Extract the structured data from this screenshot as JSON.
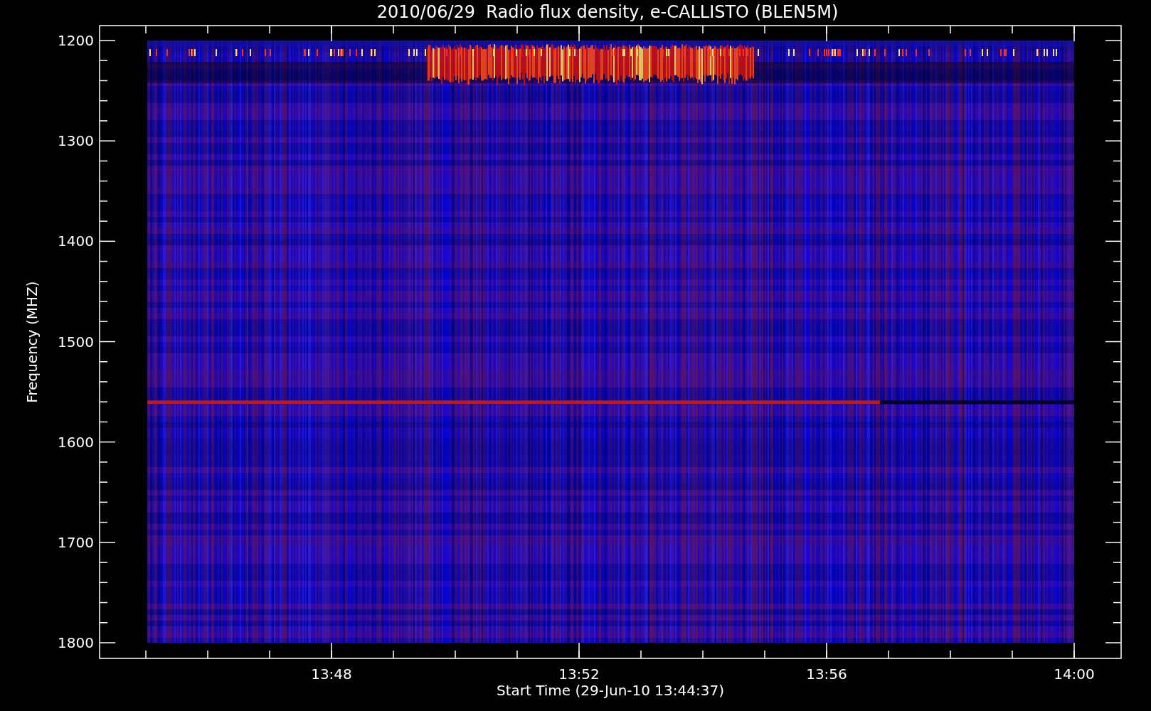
{
  "title": "2010/06/29  Radio flux density, e-CALLISTO (BLEN5M)",
  "y_axis": {
    "label": "Frequency (MHZ)",
    "ticks": [
      "1200",
      "1300",
      "1400",
      "1500",
      "1600",
      "1700",
      "1800"
    ]
  },
  "x_axis": {
    "label": "Start Time (29-Jun-10 13:44:37)",
    "ticks": [
      "13:48",
      "13:52",
      "13:56",
      "14:00"
    ]
  }
}
